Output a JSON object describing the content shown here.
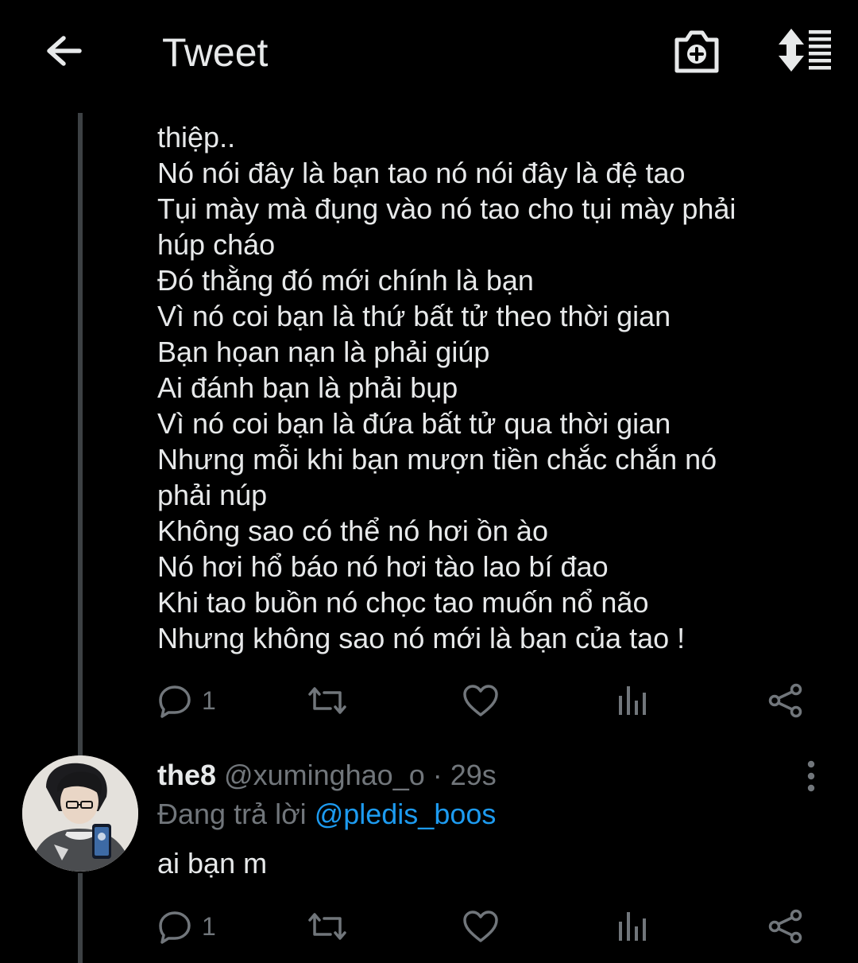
{
  "header": {
    "title": "Tweet",
    "back_icon": "arrow-left-icon",
    "camera_icon": "camera-add-icon",
    "sort_icon": "sort-replies-icon"
  },
  "tweet": {
    "lines": [
      "thiệp..",
      "Nó nói đây là bạn tao nó nói đây là đệ tao",
      "Tụi mày mà đụng vào nó tao cho tụi mày phải",
      "húp cháo",
      "Đó thằng đó mới chính là bạn",
      "Vì nó coi bạn là thứ bất tử theo thời gian",
      "Bạn họan nạn là phải giúp",
      "Ai đánh bạn là phải bụp",
      "Vì nó coi bạn là đứa bất tử qua thời gian",
      "Nhưng mỗi khi bạn mượn tiền chắc chắn nó",
      "phải núp",
      "Không sao có thể nó hơi ồn ào",
      "Nó hơi hổ báo nó hơi tào lao bí đao",
      "Khi tao buồn nó chọc tao muốn nổ não",
      "Nhưng không sao nó mới là bạn của tao !"
    ],
    "reply_count": "1"
  },
  "reply": {
    "name": "the8",
    "handle": "@xuminghao_o",
    "separator": " · ",
    "time": "29s",
    "replying_label": "Đang trả lời ",
    "replying_to": "@pledis_boos",
    "text": "ai bạn m",
    "reply_count": "1"
  },
  "colors": {
    "background": "#000000",
    "text": "#e7e9ea",
    "muted": "#71767b",
    "link": "#1d9bf0",
    "thread_line": "#3d4144"
  }
}
